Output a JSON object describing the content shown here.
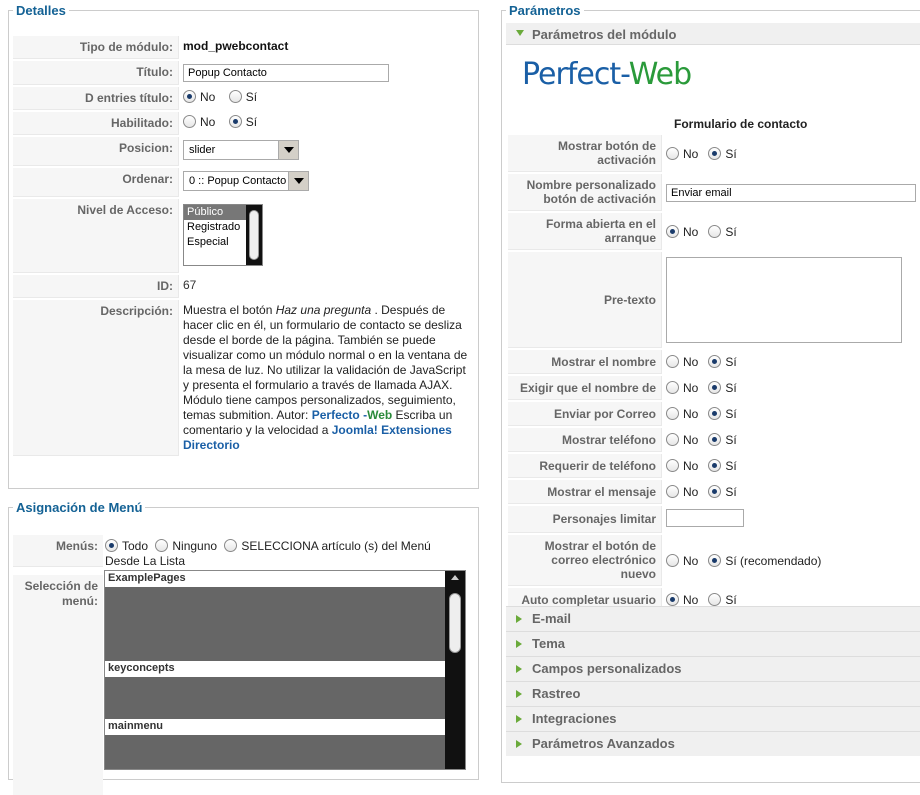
{
  "detalles": {
    "legend": "Detalles",
    "tipo_label": "Tipo de módulo:",
    "tipo_value": "mod_pwebcontact",
    "titulo_label": "Título:",
    "titulo_value": "Popup Contacto",
    "entries_label": "D entries título:",
    "habilitado_label": "Habilitado:",
    "posicion_label": "Posicion:",
    "posicion_value": "slider",
    "ordenar_label": "Ordenar:",
    "ordenar_value": "0 :: Popup Contacto",
    "acceso_label": "Nivel de Acceso:",
    "acceso_options": [
      "Público",
      "Registrado",
      "Especial"
    ],
    "id_label": "ID:",
    "id_value": "67",
    "desc_label": "Descripción:",
    "desc_1": "Muestra el botón ",
    "desc_em": "Haz una pregunta",
    "desc_2": " . Después de hacer clic en él, un formulario de contacto se desliza desde el borde de la página. También se puede visualizar como un módulo normal o en la ventana de la mesa de luz. No utilizar la validación de JavaScript y presenta el formulario a través de llamada AJAX. Módulo tiene campos personalizados, seguimiento, temas submition. Autor: ",
    "desc_link1a": "Perfecto -",
    "desc_link1b": "Web",
    "desc_3": " Escriba un comentario y la velocidad a ",
    "desc_link2": "Joomla! Extensiones Directorio"
  },
  "radio": {
    "no": "No",
    "si": "Sí",
    "si_rec": "Sí (recomendado)"
  },
  "asignacion": {
    "legend": "Asignación de Menú",
    "menus_label": "Menús:",
    "opt_todo": "Todo",
    "opt_ninguno": "Ninguno",
    "opt_select": "SELECCIONA artículo (s) del Menú Desde La Lista",
    "seleccion_label": "Selección de menú:",
    "groups": [
      "ExamplePages",
      "keyconcepts",
      "mainmenu"
    ]
  },
  "parametros": {
    "legend": "Parámetros",
    "modulo_header": "Parámetros del módulo",
    "logo_a": "Perfect-",
    "logo_b": "Web",
    "form_title": "Formulario de contacto",
    "rows": [
      {
        "label": "Mostrar botón de activación",
        "value": "si"
      },
      {
        "label": "Nombre personalizado botón de activación",
        "text": "Enviar email"
      },
      {
        "label": "Forma abierta en el arranque",
        "value": "no"
      },
      {
        "label": "Pre-texto",
        "text": ""
      },
      {
        "label": "Mostrar el nombre",
        "value": "si"
      },
      {
        "label": "Exigir que el nombre de",
        "value": "si"
      },
      {
        "label": "Enviar por Correo",
        "value": "si"
      },
      {
        "label": "Mostrar teléfono",
        "value": "si"
      },
      {
        "label": "Requerir de teléfono",
        "value": "si"
      },
      {
        "label": "Mostrar el mensaje",
        "value": "si"
      },
      {
        "label": "Personajes limitar",
        "text": ""
      },
      {
        "label": "Mostrar el botón de correo electrónico nuevo",
        "value": "si"
      },
      {
        "label": "Auto completar usuario",
        "value": "no"
      }
    ],
    "sections": [
      "E-mail",
      "Tema",
      "Campos personalizados",
      "Rastreo",
      "Integraciones",
      "Parámetros Avanzados"
    ]
  }
}
